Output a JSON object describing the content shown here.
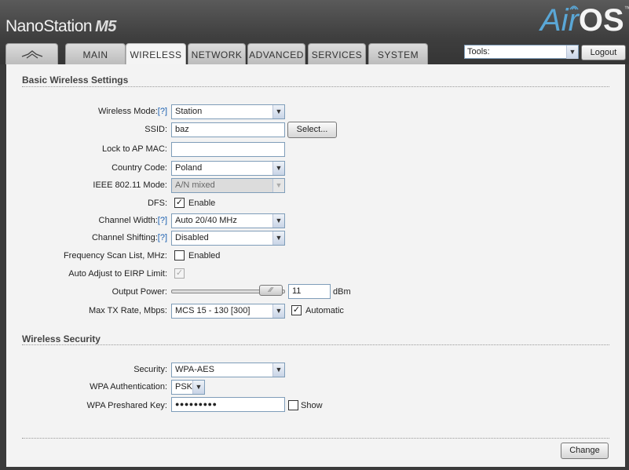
{
  "header": {
    "brand_name": "NanoStation",
    "brand_model": "M5",
    "logo_air": "Air",
    "logo_os": "OS",
    "logo_tm": "™"
  },
  "tabs": [
    {
      "label": "",
      "icon": "ubiquiti-logo-icon"
    },
    {
      "label": "MAIN"
    },
    {
      "label": "WIRELESS",
      "active": true
    },
    {
      "label": "NETWORK"
    },
    {
      "label": "ADVANCED"
    },
    {
      "label": "SERVICES"
    },
    {
      "label": "SYSTEM"
    }
  ],
  "toolbar": {
    "tools_value": "Tools:",
    "logout_label": "Logout"
  },
  "basic": {
    "title": "Basic Wireless Settings",
    "help": "[?]",
    "wireless_mode_label": "Wireless Mode:",
    "wireless_mode_value": "Station",
    "ssid_label": "SSID:",
    "ssid_value": "baz",
    "select_button": "Select...",
    "lock_mac_label": "Lock to AP MAC:",
    "lock_mac_value": "",
    "country_label": "Country Code:",
    "country_value": "Poland",
    "ieee_label": "IEEE 802.11 Mode:",
    "ieee_value": "A/N mixed",
    "dfs_label": "DFS:",
    "dfs_text": "Enable",
    "dfs_checked": true,
    "channel_width_label": "Channel Width:",
    "channel_width_value": "Auto 20/40 MHz",
    "channel_shift_label": "Channel Shifting:",
    "channel_shift_value": "Disabled",
    "freq_scan_label": "Frequency Scan List, MHz:",
    "freq_scan_text": "Enabled",
    "freq_scan_checked": false,
    "eirp_label": "Auto Adjust to EIRP Limit:",
    "eirp_checked": true,
    "output_power_label": "Output Power:",
    "output_power_value": "11",
    "output_power_unit": "dBm",
    "max_tx_label": "Max TX Rate, Mbps:",
    "max_tx_value": "MCS 15 - 130 [300]",
    "automatic_text": "Automatic",
    "automatic_checked": true
  },
  "security": {
    "title": "Wireless Security",
    "security_label": "Security:",
    "security_value": "WPA-AES",
    "wpa_auth_label": "WPA Authentication:",
    "wpa_auth_value": "PSK",
    "psk_label": "WPA Preshared Key:",
    "psk_value": "●●●●●●●●●",
    "show_text": "Show",
    "show_checked": false
  },
  "footer": {
    "change_label": "Change"
  },
  "colors": {
    "header_bg": "#3e3e3e",
    "panel_bg": "#f3f3f3",
    "logo_air": "#5aa7d6",
    "help_link": "#1a5fb0"
  }
}
